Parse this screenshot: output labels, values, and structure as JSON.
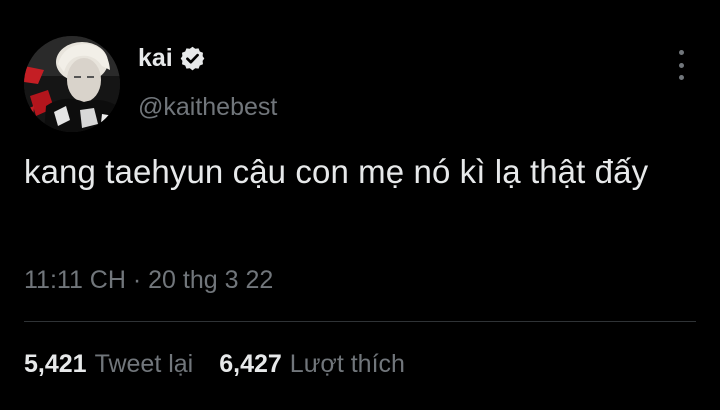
{
  "user": {
    "display_name": "kai",
    "handle": "@kaithebest",
    "verified": true
  },
  "tweet": {
    "text": "kang taehyun cậu con mẹ nó kì lạ thật đấy",
    "time": "11:11 CH",
    "separator": "·",
    "date": "20 thg 3 22"
  },
  "stats": {
    "retweets_count": "5,421",
    "retweets_label": "Tweet lại",
    "likes_count": "6,427",
    "likes_label": "Lượt thích"
  },
  "icons": {
    "verified": "verified-badge-icon",
    "more": "more-options-icon"
  },
  "colors": {
    "background": "#000000",
    "primary_text": "#e7e9ea",
    "secondary_text": "#71767b",
    "divider": "#2f3336"
  }
}
